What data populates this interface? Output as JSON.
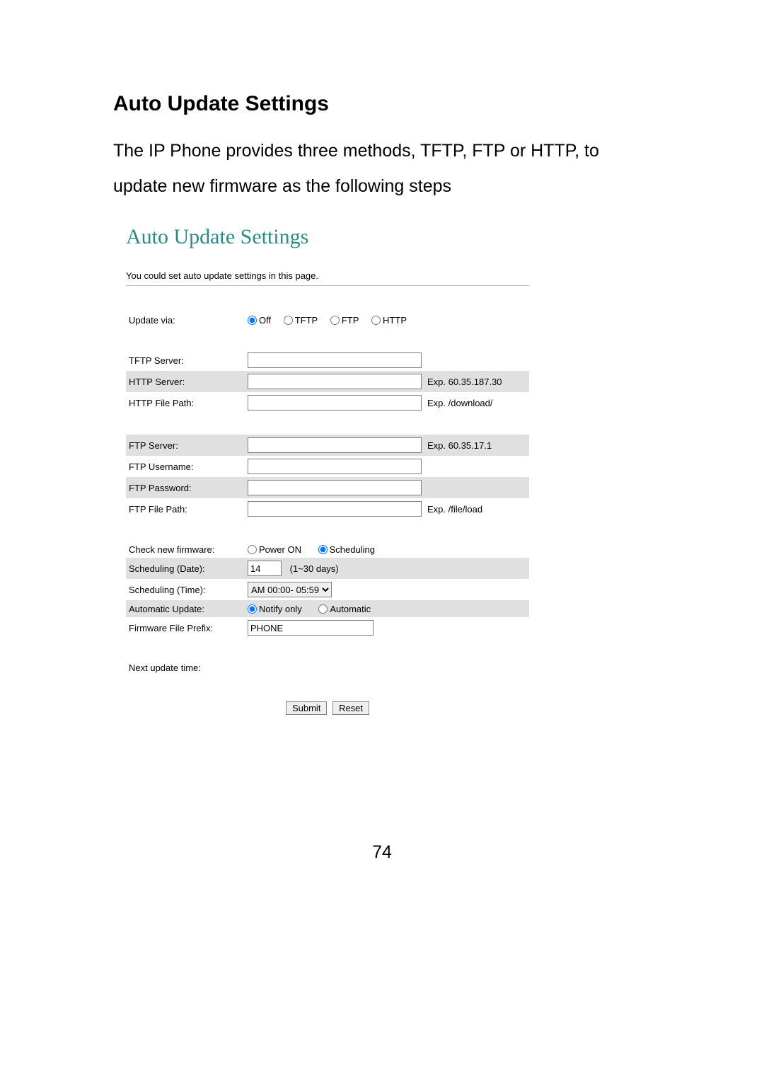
{
  "doc": {
    "heading": "Auto Update Settings",
    "paragraph": "The IP Phone provides three methods, TFTP, FTP or HTTP, to update new firmware as the following steps",
    "page_number": "74"
  },
  "panel": {
    "title": "Auto Update Settings",
    "description": "You could set auto update settings in this page."
  },
  "labels": {
    "update_via": "Update via:",
    "tftp_server": "TFTP Server:",
    "http_server": "HTTP Server:",
    "http_file_path": "HTTP File Path:",
    "ftp_server": "FTP Server:",
    "ftp_username": "FTP Username:",
    "ftp_password": "FTP Password:",
    "ftp_file_path": "FTP File Path:",
    "check_new_firmware": "Check new firmware:",
    "scheduling_date": "Scheduling (Date):",
    "scheduling_time": "Scheduling (Time):",
    "automatic_update": "Automatic Update:",
    "firmware_file_prefix": "Firmware File Prefix:",
    "next_update_time": "Next update time:"
  },
  "radios": {
    "off": "Off",
    "tftp": "TFTP",
    "ftp": "FTP",
    "http": "HTTP",
    "power_on": "Power ON",
    "scheduling": "Scheduling",
    "notify_only": "Notify only",
    "automatic": "Automatic"
  },
  "hints": {
    "http_server": "Exp. 60.35.187.30",
    "http_file_path": "Exp. /download/",
    "ftp_server": "Exp. 60.35.17.1",
    "ftp_file_path": "Exp. /file/load",
    "scheduling_date": "(1~30 days)"
  },
  "values": {
    "tftp_server": "",
    "http_server": "",
    "http_file_path": "",
    "ftp_server": "",
    "ftp_username": "",
    "ftp_password": "",
    "ftp_file_path": "",
    "scheduling_date": "14",
    "scheduling_time": "AM 00:00- 05:59",
    "firmware_file_prefix": "PHONE",
    "next_update_time": ""
  },
  "buttons": {
    "submit": "Submit",
    "reset": "Reset"
  }
}
